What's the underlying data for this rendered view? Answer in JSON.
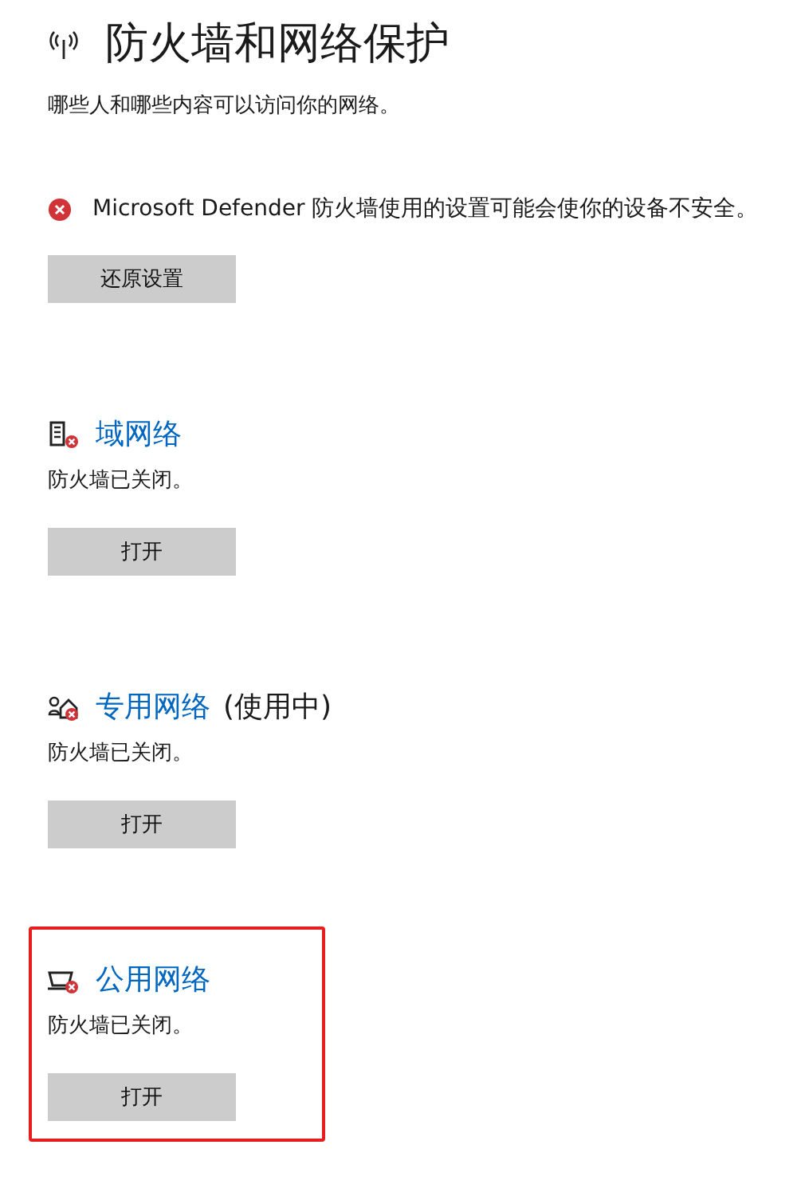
{
  "page": {
    "title": "防火墙和网络保护",
    "subtitle": "哪些人和哪些内容可以访问你的网络。"
  },
  "warning": {
    "text": "Microsoft Defender 防火墙使用的设置可能会使你的设备不安全。",
    "button": "还原设置"
  },
  "networks": [
    {
      "kind": "domain",
      "name": "域网络",
      "status": "防火墙已关闭。",
      "button": "打开",
      "highlighted": false
    },
    {
      "kind": "private",
      "name": "专用网络",
      "suffix": "(使用中)",
      "status": "防火墙已关闭。",
      "button": "打开",
      "highlighted": false
    },
    {
      "kind": "public",
      "name": "公用网络",
      "status": "防火墙已关闭。",
      "button": "打开",
      "highlighted": true
    }
  ]
}
